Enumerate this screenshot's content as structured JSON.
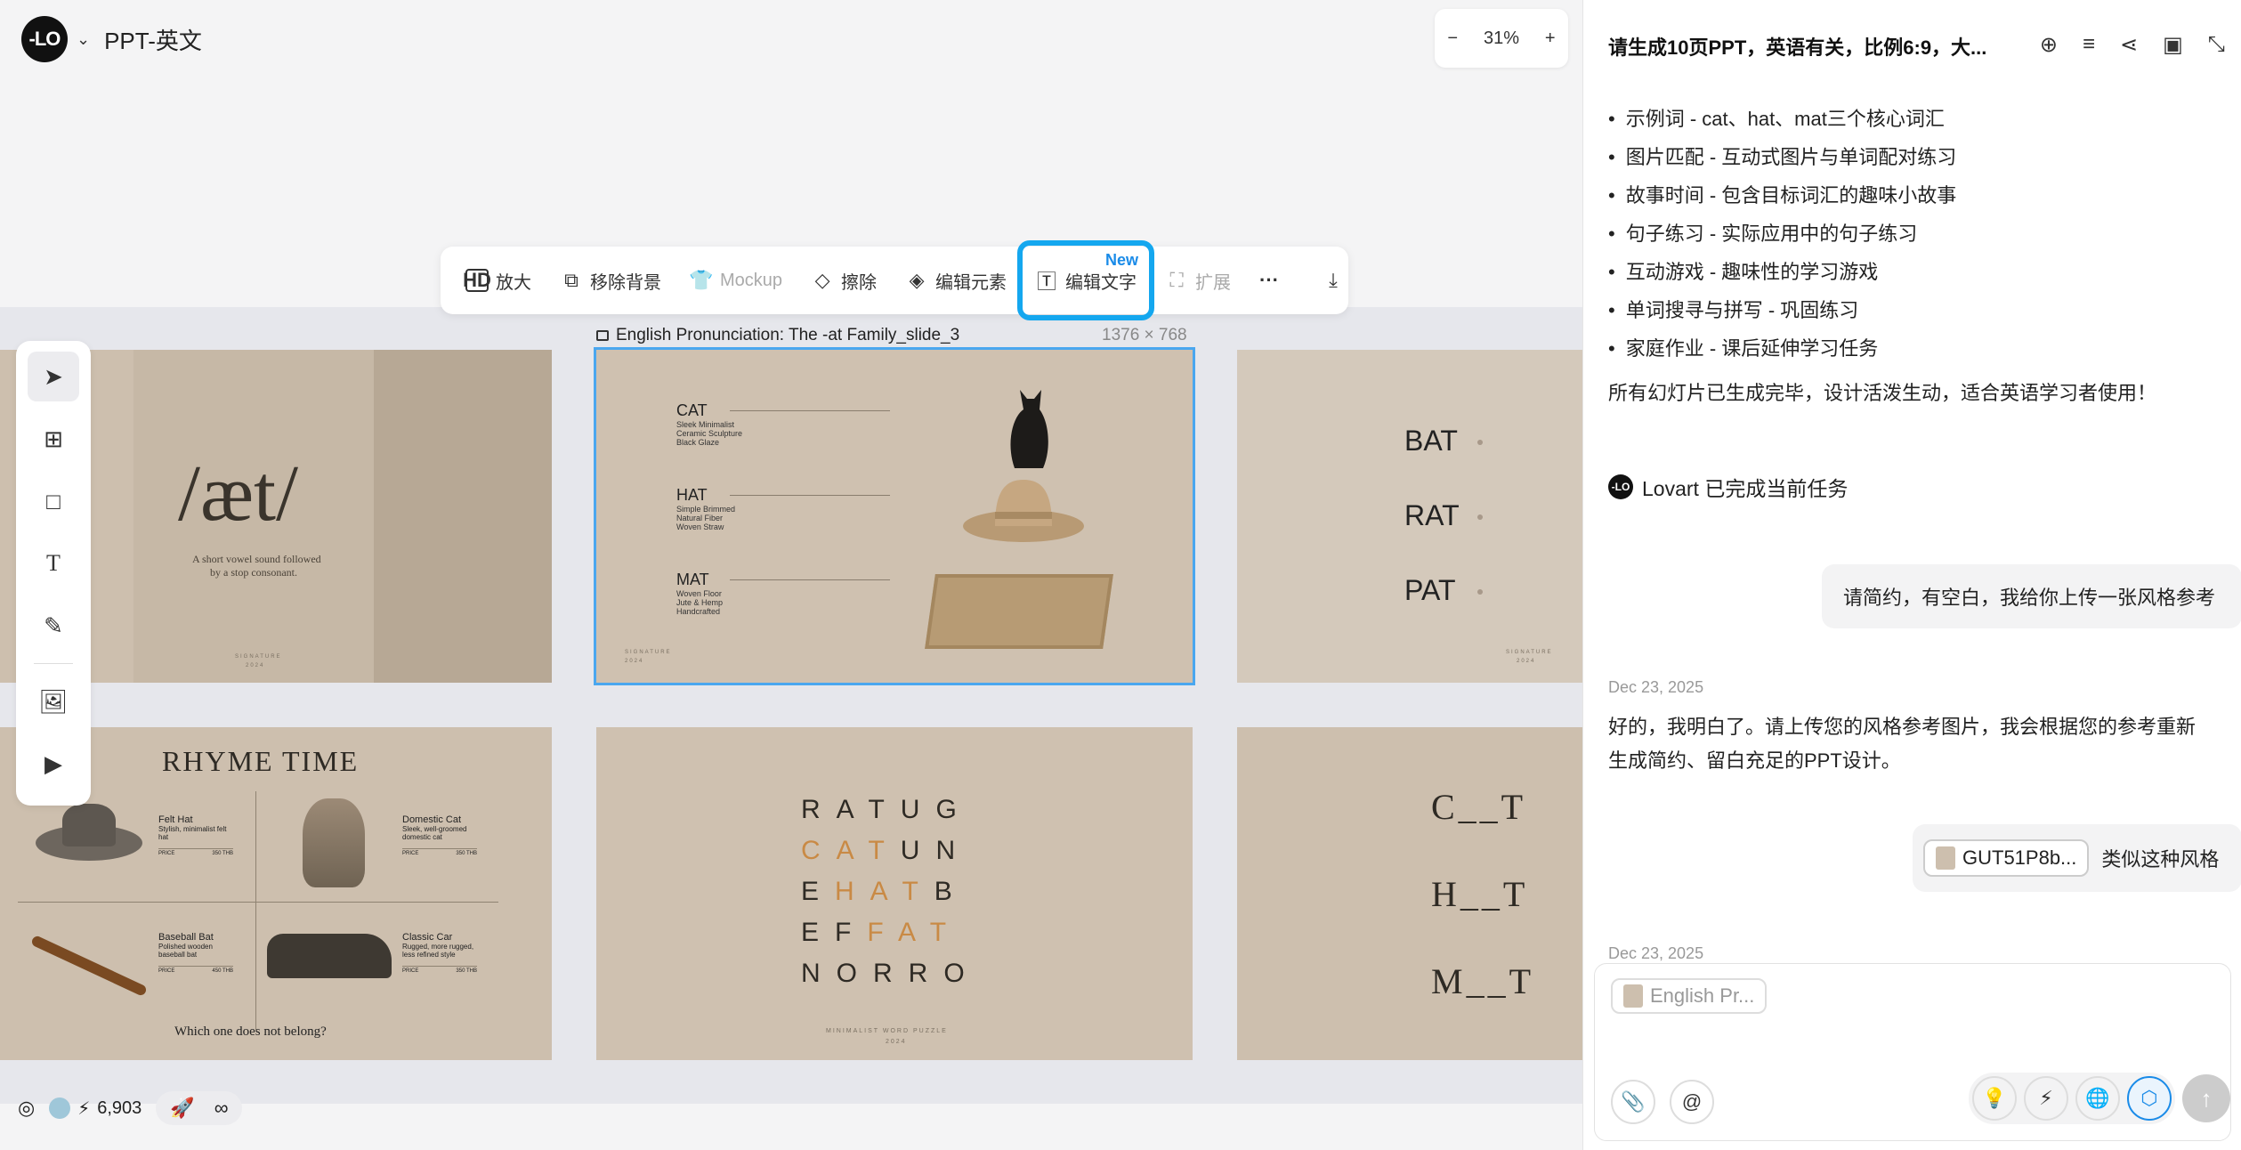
{
  "app": {
    "logo_text": "-LO",
    "title": "PPT-英文"
  },
  "zoom": {
    "minus": "−",
    "level": "31%",
    "plus": "+"
  },
  "toolbar": {
    "upscale": "放大",
    "hd": "HD",
    "remove_bg": "移除背景",
    "mockup": "Mockup",
    "erase": "擦除",
    "edit_elements": "编辑元素",
    "edit_text": "编辑文字",
    "new_badge": "New",
    "expand": "扩展",
    "more": "···"
  },
  "selected_slide": {
    "label": "English Pronunciation: The -at Family_slide_3",
    "dims": "1376 × 768"
  },
  "slides": {
    "s1": {
      "title": "/æt/",
      "sub1": "A short vowel sound followed",
      "sub2": "by a stop consonant.",
      "footer1": "SIGNATURE",
      "footer2": "2024"
    },
    "s2": {
      "items": [
        {
          "name": "CAT",
          "d1": "Sleek Minimalist",
          "d2": "Ceramic Sculpture",
          "d3": "Black Glaze"
        },
        {
          "name": "HAT",
          "d1": "Simple Brimmed",
          "d2": "Natural Fiber",
          "d3": "Woven Straw"
        },
        {
          "name": "MAT",
          "d1": "Woven Floor",
          "d2": "Jute & Hemp",
          "d3": "Handcrafted"
        }
      ],
      "footer1": "SIGNATURE",
      "footer2": "2024"
    },
    "s3": {
      "words": [
        "BAT",
        "RAT",
        "PAT"
      ],
      "footer1": "SIGNATURE",
      "footer2": "2024"
    },
    "s4": {
      "title": "RHYME TIME",
      "q1": {
        "name": "Felt Hat",
        "d": "Stylish, minimalist felt hat",
        "price": "PRICE",
        "pv": "350 THB"
      },
      "q2": {
        "name": "Domestic Cat",
        "d": "Sleek, well-groomed domestic cat",
        "price": "PRICE",
        "pv": "350 THB"
      },
      "q3": {
        "name": "Baseball Bat",
        "d": "Polished wooden baseball bat",
        "price": "PRICE",
        "pv": "450 THB"
      },
      "q4": {
        "name": "Classic Car",
        "d": "Rugged, more rugged, less refined style",
        "price": "PRICE",
        "pv": "350 THB"
      },
      "question": "Which one does not belong?"
    },
    "s5": {
      "rows": [
        "RATUG",
        "CATUN",
        "EHATB",
        "EFFAT",
        "NORRO"
      ],
      "footer1": "MINIMALIST WORD PUZZLE",
      "footer2": "2024"
    },
    "s6": {
      "rows": [
        "C__T",
        "H__T",
        "M__T"
      ]
    }
  },
  "bottom": {
    "credits": "6,903",
    "infinity": "∞"
  },
  "panel": {
    "header": "请生成10页PPT，英语有关，比例6:9，大...",
    "list": [
      "示例词 - cat、hat、mat三个核心词汇",
      "图片匹配 - 互动式图片与单词配对练习",
      "故事时间 - 包含目标词汇的趣味小故事",
      "句子练习 - 实际应用中的句子练习",
      "互动游戏 - 趣味性的学习游戏",
      "单词搜寻与拼写 - 巩固练习",
      "家庭作业 - 课后延伸学习任务"
    ],
    "done_text": "所有幻灯片已生成完毕，设计活泼生动，适合英语学习者使用！",
    "lovart": "Lovart 已完成当前任务",
    "user_msg1": "请简约，有空白，我给你上传一张风格参考",
    "date1": "Dec 23, 2025",
    "reply1": "好的，我明白了。请上传您的风格参考图片，我会根据您的参考重新",
    "reply2": "生成简约、留白充足的PPT设计。",
    "chip_name": "GUT51P8b...",
    "user_msg2": "类似这种风格",
    "date2": "Dec 23, 2025",
    "input_chip": "English Pr..."
  }
}
